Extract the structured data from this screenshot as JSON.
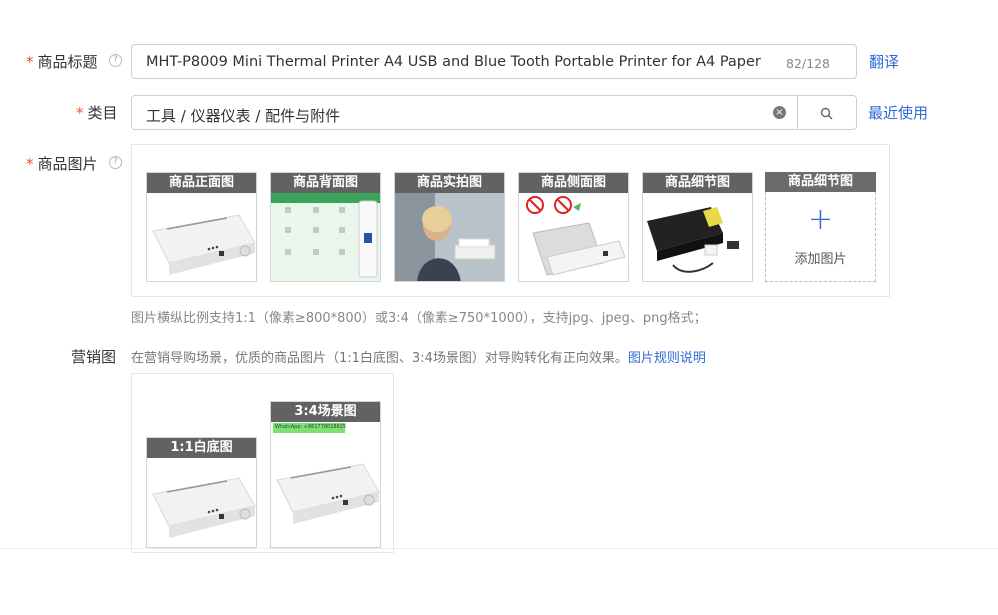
{
  "fields": {
    "title": {
      "label": "商品标题",
      "value": "MHT-P8009 Mini Thermal Printer A4 USB and Blue Tooth Portable Printer for A4 Paper",
      "counter": "82/128",
      "translate_link": "翻译"
    },
    "category": {
      "label": "类目",
      "value": "工具 / 仪器仪表 / 配件与附件",
      "recent_link": "最近使用"
    },
    "images": {
      "label": "商品图片",
      "thumbs": [
        {
          "label": "商品正面图",
          "art": "printer-front"
        },
        {
          "label": "商品背面图",
          "art": "printer-features"
        },
        {
          "label": "商品实拍图",
          "art": "woman-with-printer"
        },
        {
          "label": "商品侧面图",
          "art": "printer-side"
        },
        {
          "label": "商品细节图",
          "art": "printer-detail"
        }
      ],
      "add_slot": {
        "label": "商品细节图",
        "plus": "+",
        "text": "添加图片"
      },
      "hint": "图片横纵比例支持1:1（像素≥800*800）或3:4（像素≥750*1000），支持jpg、jpeg、png格式；"
    },
    "marketing": {
      "label": "营销图",
      "description": "在营销导购场景，优质的商品图片（1:1白底图、3:4场景图）对导购转化有正向效果。",
      "rules_link": "图片规则说明",
      "thumbs": [
        {
          "label": "1:1白底图"
        },
        {
          "label": "3:4场景图",
          "overlay": "WhatsApp: +861778018825"
        }
      ]
    }
  },
  "help_glyph": "?",
  "clear_glyph": "×",
  "colors": {
    "accent": "#2e6bd3",
    "required": "#e8542a"
  }
}
